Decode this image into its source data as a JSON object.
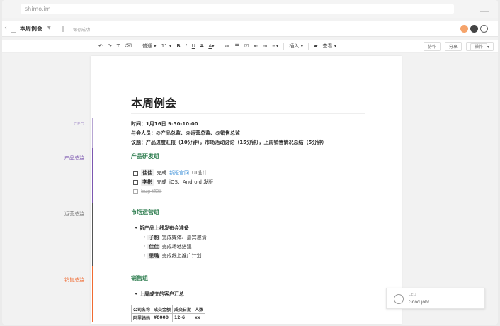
{
  "browser": {
    "url": "shimo.im"
  },
  "header": {
    "doc_title": "本周例会",
    "save_status": "保存成功"
  },
  "toolbar": {
    "style_select": "普通",
    "size_select": "11",
    "bold": "B",
    "italic": "I",
    "underline": "U",
    "strike": "S",
    "font_color": "A",
    "insert": "插入",
    "view": "查看",
    "collab": "协作",
    "share": "分享",
    "actions": "操作"
  },
  "doc": {
    "title": "本周例会",
    "time_line": "时间：1月16日 9:30-10:00",
    "attendees_line": "与会人员：@产品总监、@运营总监、@销售总监",
    "agenda_line": "议题：产品进度汇报（10分钟），市场活动讨论（15分钟），上周销售情况总结（5分钟）",
    "sections": [
      {
        "heading": "产品研发组",
        "tasks": [
          {
            "assignee": "佳佳",
            "pre": "完成",
            "link": "新版官网",
            "post": "UI设计"
          },
          {
            "assignee": "李彬",
            "pre": "完成",
            "post": "iOS、Android 发版"
          },
          {
            "text": "bug 修复"
          }
        ]
      },
      {
        "heading": "市场运营组",
        "bullet": "新产品上线发布会准备",
        "subitems": [
          {
            "assignee": "子豹",
            "text": "完成媒体、嘉宾邀请"
          },
          {
            "assignee": "佳佳",
            "text": "完成场地搭建"
          },
          {
            "assignee": "思璐",
            "text": "完成线上推广计划"
          }
        ]
      },
      {
        "heading": "销售组",
        "bullet": "上周成交的客户汇总",
        "table": {
          "headers": [
            "公司名称",
            "成交金额",
            "成交日期",
            "人数"
          ],
          "rows": [
            [
              "阿里妈妈",
              "¥8000",
              "12-6",
              "xx"
            ]
          ]
        }
      }
    ]
  },
  "sidebar_roles": [
    {
      "label": "CEO",
      "color": "#b7a6d3"
    },
    {
      "label": "产品总监",
      "color": "#7c57b0"
    },
    {
      "label": "运营总监",
      "color": "#555555"
    },
    {
      "label": "销售总监",
      "color": "#f06b32"
    }
  ],
  "comment": {
    "role": "CEO",
    "text": "Good job!"
  }
}
